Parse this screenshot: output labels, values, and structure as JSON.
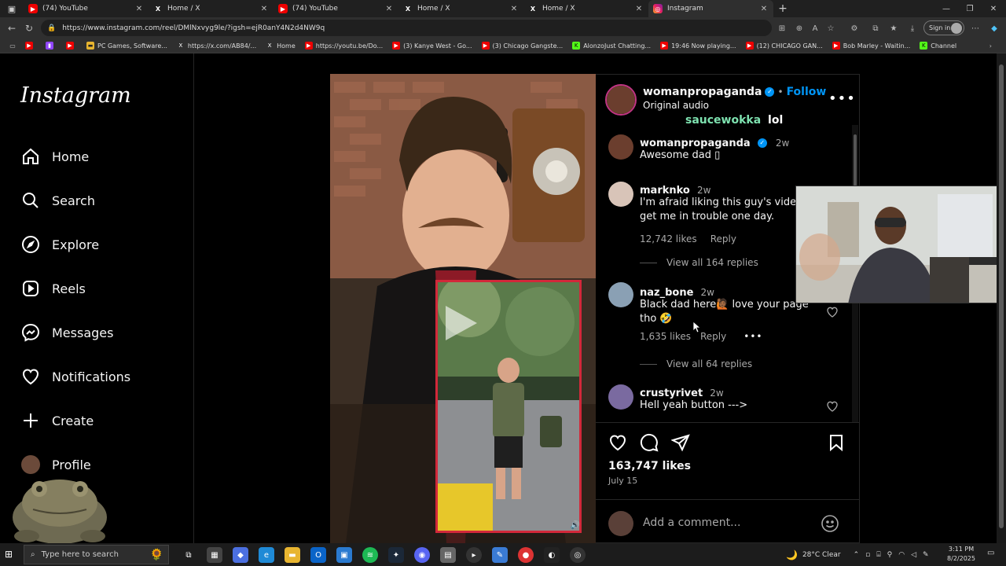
{
  "browser": {
    "tabs": [
      {
        "title": "(74) YouTube",
        "icon": "youtube-icon",
        "active": false
      },
      {
        "title": "Home / X",
        "icon": "x-icon",
        "active": false
      },
      {
        "title": "(74) YouTube",
        "icon": "youtube-icon",
        "active": false
      },
      {
        "title": "Home / X",
        "icon": "x-icon",
        "active": false
      },
      {
        "title": "Home / X",
        "icon": "x-icon",
        "active": false
      },
      {
        "title": "Instagram",
        "icon": "instagram-icon",
        "active": true
      }
    ],
    "url": "https://www.instagram.com/reel/DMlNxvyg9le/?igsh=ejR0anY4N2d4NW9q",
    "signin_label": "Sign in",
    "bookmarks": [
      {
        "label": "",
        "icon": "youtube-icon"
      },
      {
        "label": "",
        "icon": "twitch-icon"
      },
      {
        "label": "",
        "icon": "youtube-icon"
      },
      {
        "label": "PC Games, Software...",
        "icon": "folder-icon"
      },
      {
        "label": "https://x.com/AB84/...",
        "icon": "x-icon"
      },
      {
        "label": "Home",
        "icon": "x-icon"
      },
      {
        "label": "https://youtu.be/Do...",
        "icon": "youtube-icon"
      },
      {
        "label": "(3) Kanye West - Go...",
        "icon": "youtube-icon"
      },
      {
        "label": "(3) Chicago Gangste...",
        "icon": "youtube-icon"
      },
      {
        "label": "AlonzoJust Chatting...",
        "icon": "kick-icon"
      },
      {
        "label": "19:46 Now playing...",
        "icon": "youtube-icon"
      },
      {
        "label": "(12) CHICAGO GAN...",
        "icon": "youtube-icon"
      },
      {
        "label": "Bob Marley - Waitin...",
        "icon": "youtube-icon"
      },
      {
        "label": "Channel",
        "icon": "kick-icon"
      }
    ]
  },
  "sidebar": {
    "logo": "Instagram",
    "items": [
      {
        "label": "Home",
        "icon": "home-icon"
      },
      {
        "label": "Search",
        "icon": "search-icon"
      },
      {
        "label": "Explore",
        "icon": "compass-icon"
      },
      {
        "label": "Reels",
        "icon": "reels-icon"
      },
      {
        "label": "Messages",
        "icon": "messenger-icon"
      },
      {
        "label": "Notifications",
        "icon": "heart-icon"
      },
      {
        "label": "Create",
        "icon": "plus-icon"
      },
      {
        "label": "Profile",
        "icon": "avatar"
      }
    ]
  },
  "post": {
    "author": "womanpropaganda",
    "follow_label": "Follow",
    "audio": "Original audio",
    "overlay_user": "saucewokka",
    "overlay_text": "lol",
    "likes": "163,747 likes",
    "date": "July 15",
    "comment_placeholder": "Add a comment..."
  },
  "comments": [
    {
      "user": "womanpropaganda",
      "time": "2w",
      "text": "Awesome dad ▯",
      "verified": true
    },
    {
      "user": "marknko",
      "time": "2w",
      "text1": "I'm afraid liking this guy's videos",
      "text2": "get me in trouble one day.",
      "likes": "12,742 likes",
      "reply": "Reply",
      "view_replies": "View all 164 replies"
    },
    {
      "user": "naz_bone",
      "time": "2w",
      "text1": "Black dad here🙋🏾 love your page",
      "text2": "tho 🤣",
      "likes": "1,635 likes",
      "reply": "Reply",
      "view_replies": "View all 64 replies"
    },
    {
      "user": "crustyrivet",
      "time": "2w",
      "text": "Hell yeah button --->"
    }
  ],
  "taskbar": {
    "search_placeholder": "Type here to search",
    "weather": "28°C Clear",
    "time": "3:11 PM",
    "date": "8/2/2025"
  },
  "colors": {
    "accent_blue": "#0095f6",
    "overlay_green": "#7ee2b0",
    "inset_border": "#d2283a"
  }
}
